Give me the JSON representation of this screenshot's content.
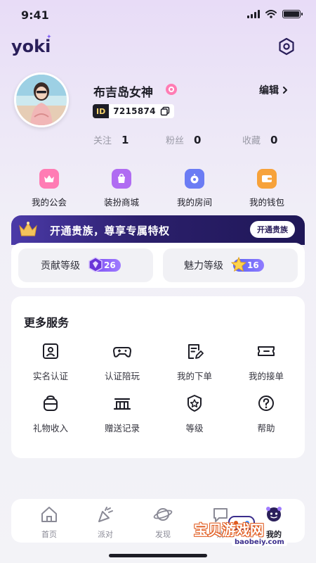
{
  "status_bar": {
    "time": "9:41"
  },
  "app": {
    "logo": "yoki"
  },
  "profile": {
    "name": "布吉岛女神",
    "edit_label": "编辑",
    "id_tag": "ID",
    "id_number": "7215874",
    "stats": [
      {
        "label": "关注",
        "value": "1"
      },
      {
        "label": "粉丝",
        "value": "0"
      },
      {
        "label": "收藏",
        "value": "0"
      }
    ]
  },
  "quick_entries": [
    {
      "label": "我的公会",
      "icon": "guild-icon",
      "color": "#ff7cb4"
    },
    {
      "label": "装扮商城",
      "icon": "shopping-bag-icon",
      "color": "#b06cf2"
    },
    {
      "label": "我的房间",
      "icon": "room-icon",
      "color": "#6b7cf4"
    },
    {
      "label": "我的钱包",
      "icon": "wallet-icon",
      "color": "#f7a23a"
    }
  ],
  "vip_banner": {
    "text": "开通贵族，尊享专属特权",
    "button": "开通贵族"
  },
  "levels": [
    {
      "label": "贡献等级",
      "value": "26"
    },
    {
      "label": "魅力等级",
      "value": "16"
    }
  ],
  "services": {
    "title": "更多服务",
    "items": [
      {
        "label": "实名认证",
        "icon": "id-card-icon"
      },
      {
        "label": "认证陪玩",
        "icon": "gamepad-icon"
      },
      {
        "label": "我的下单",
        "icon": "order-edit-icon"
      },
      {
        "label": "我的接单",
        "icon": "ticket-icon"
      },
      {
        "label": "礼物收入",
        "icon": "gift-income-icon"
      },
      {
        "label": "赠送记录",
        "icon": "record-icon"
      },
      {
        "label": "等级",
        "icon": "level-badge-icon"
      },
      {
        "label": "帮助",
        "icon": "help-icon"
      }
    ]
  },
  "tabbar": {
    "items": [
      {
        "label": "首页",
        "icon": "home-icon"
      },
      {
        "label": "派对",
        "icon": "party-icon"
      },
      {
        "label": "发现",
        "icon": "planet-icon"
      },
      {
        "label": "消",
        "icon": "message-icon"
      },
      {
        "label": "我的",
        "icon": "profile-icon"
      }
    ]
  },
  "watermark": {
    "text": "宝贝游戏网",
    "url": "baobeiy.com"
  },
  "colors": {
    "accent": "#7b4cf2",
    "banner_dark": "#1f1757",
    "text": "#1d1d26"
  }
}
